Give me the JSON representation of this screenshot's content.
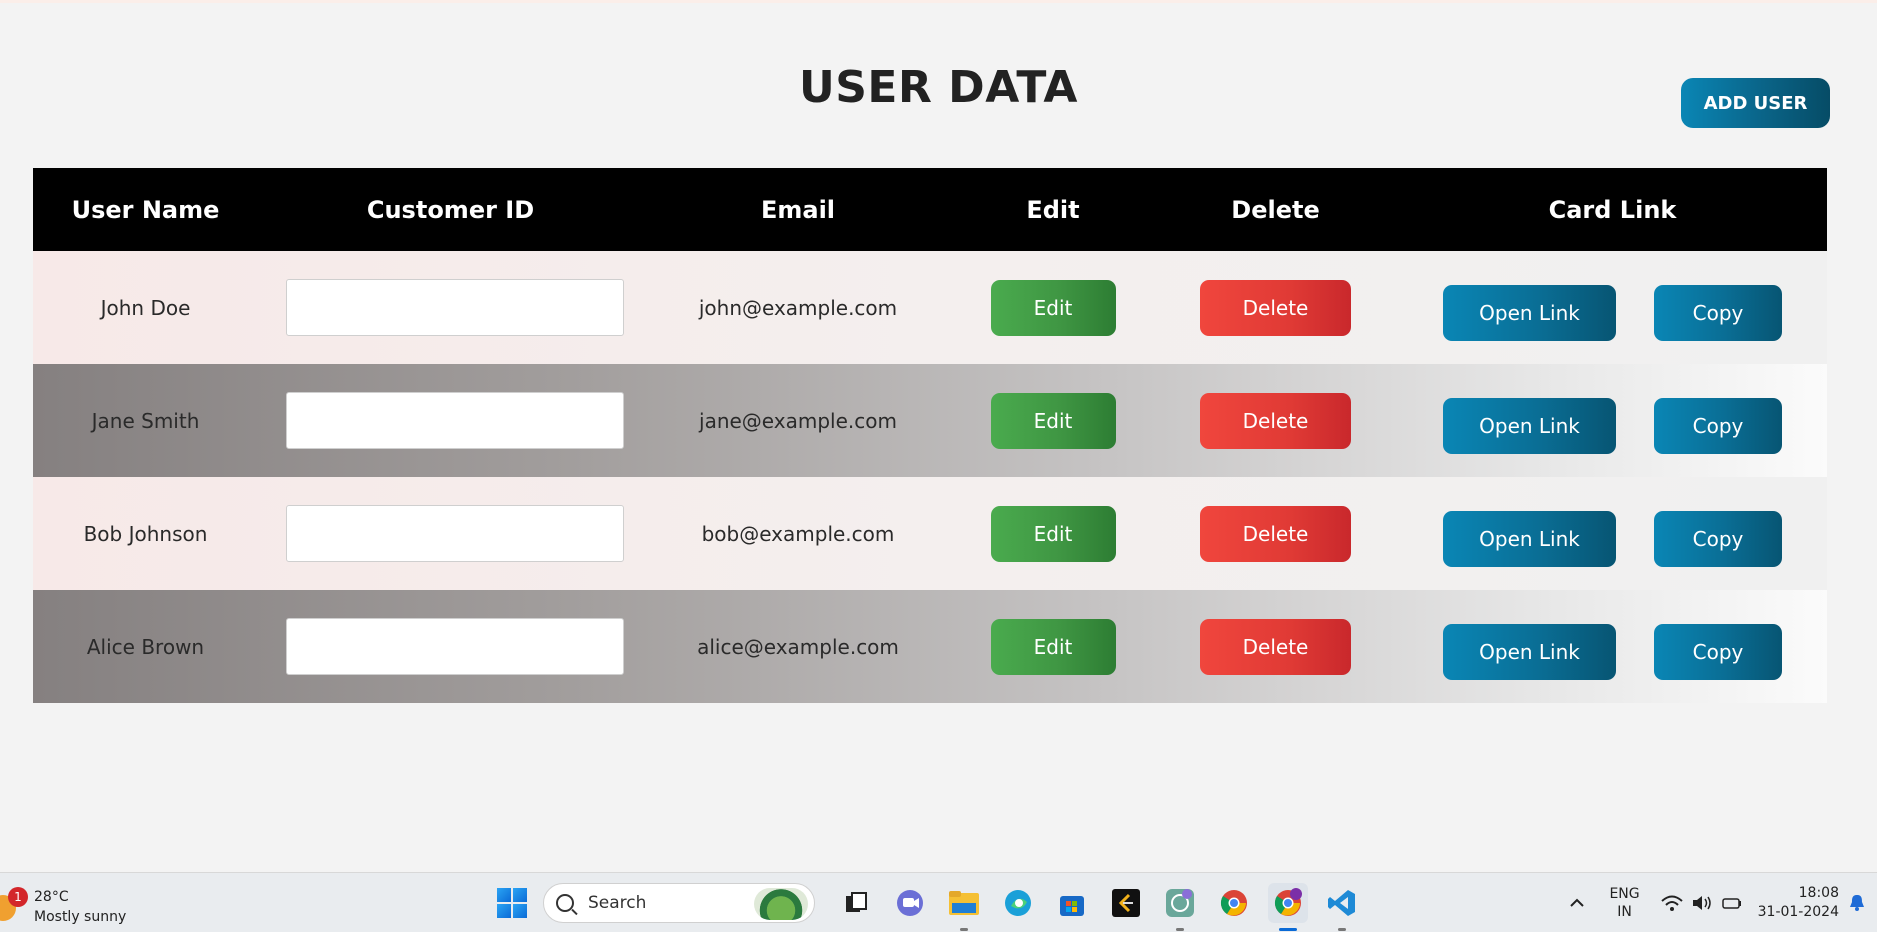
{
  "page": {
    "title": "USER DATA",
    "add_user_label": "ADD USER"
  },
  "table": {
    "headers": [
      "User Name",
      "Customer ID",
      "Email",
      "Edit",
      "Delete",
      "Card Link"
    ],
    "rows": [
      {
        "name": "John Doe",
        "customer_id": "",
        "email": "john@example.com",
        "edit": "Edit",
        "delete": "Delete",
        "open_link": "Open Link",
        "copy": "Copy"
      },
      {
        "name": "Jane Smith",
        "customer_id": "",
        "email": "jane@example.com",
        "edit": "Edit",
        "delete": "Delete",
        "open_link": "Open Link",
        "copy": "Copy"
      },
      {
        "name": "Bob Johnson",
        "customer_id": "",
        "email": "bob@example.com",
        "edit": "Edit",
        "delete": "Delete",
        "open_link": "Open Link",
        "copy": "Copy"
      },
      {
        "name": "Alice Brown",
        "customer_id": "",
        "email": "alice@example.com",
        "edit": "Edit",
        "delete": "Delete",
        "open_link": "Open Link",
        "copy": "Copy"
      }
    ]
  },
  "taskbar": {
    "weather": {
      "badge": "1",
      "temp": "28°C",
      "condition": "Mostly sunny"
    },
    "search_label": "Search",
    "apps": [
      "task-view-icon",
      "teams-icon",
      "file-explorer-icon",
      "edge-icon",
      "store-icon",
      "app-icon",
      "chatgpt-icon",
      "chrome-icon",
      "chrome-profile-icon",
      "vscode-icon"
    ],
    "profile_badge": "S",
    "lang_top": "ENG",
    "lang_bottom": "IN",
    "time": "18:08",
    "date": "31-01-2024"
  },
  "colors": {
    "accent_blue": "#0a6e95",
    "edit_green": "#3f9643",
    "delete_red": "#e03a35",
    "header_black": "#000000"
  }
}
